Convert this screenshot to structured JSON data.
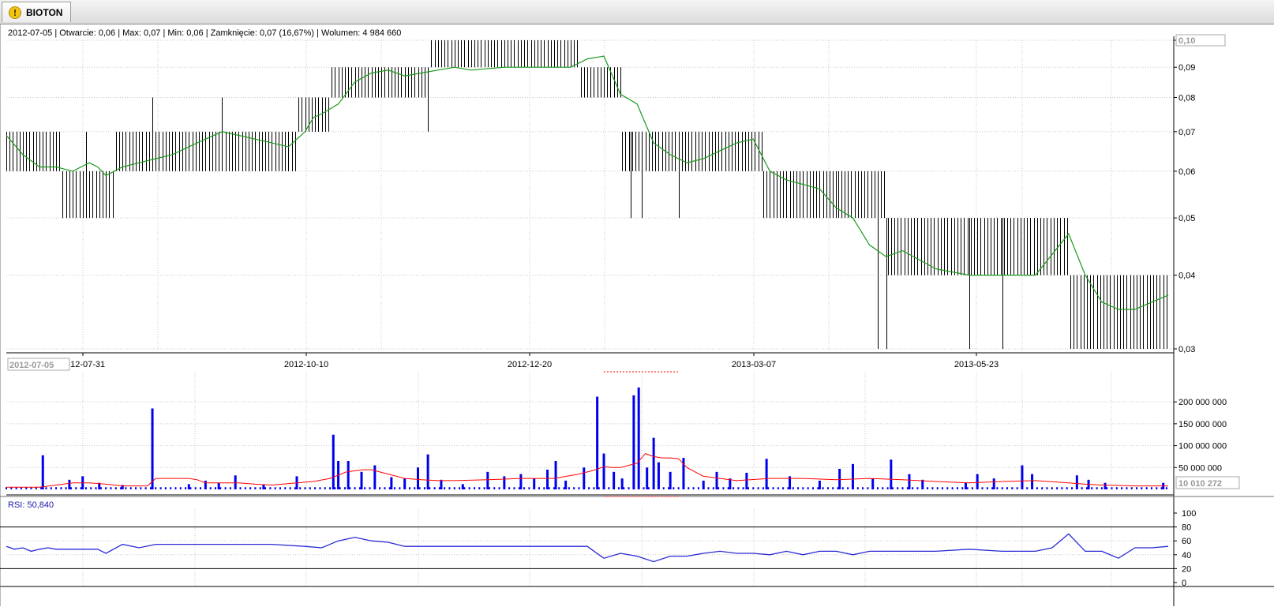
{
  "tab": {
    "label": "BIOTON",
    "icon": "warning-icon"
  },
  "info": {
    "text": "2012-07-05 | Otwarcie: 0,06 | Max: 0,07 | Min: 0,06 | Zamknięcie: 0,07 (16,67%)  | Wolumen: 4 984 660"
  },
  "cursor": {
    "date": "2012-07-05",
    "price": "0,10",
    "volume": "10 010 272"
  },
  "rsi": {
    "label": "RSI: 50,840"
  },
  "colors": {
    "ma": "#1a9a1a",
    "volume_bars": "#0000ee",
    "volume_ma": "#ff0000",
    "rsi_line": "#2a2ad6",
    "rsi_label": "#1a1aaa"
  },
  "chart_data": [
    {
      "type": "bar",
      "subtype": "ohlc-price",
      "x_ticks": [
        "2012-07-31",
        "2012-10-10",
        "2012-12-20",
        "2013-03-07",
        "2013-05-23"
      ],
      "y_ticks": [
        "0,10",
        "0,09",
        "0,08",
        "0,07",
        "0,06",
        "0,05",
        "0,04",
        "0,03"
      ],
      "ylim": [
        0.03,
        0.1
      ],
      "y_scale": "log",
      "grid": true,
      "segments": [
        {
          "from": 0,
          "to": 33,
          "low": 0.06,
          "high": 0.07
        },
        {
          "from": 34,
          "to": 65,
          "low": 0.05,
          "high": 0.06
        },
        {
          "from": 66,
          "to": 175,
          "low": 0.06,
          "high": 0.07
        },
        {
          "from": 176,
          "to": 195,
          "low": 0.07,
          "high": 0.08
        },
        {
          "from": 196,
          "to": 255,
          "low": 0.08,
          "high": 0.09
        },
        {
          "from": 256,
          "to": 345,
          "low": 0.09,
          "high": 0.1
        },
        {
          "from": 346,
          "to": 370,
          "low": 0.08,
          "high": 0.09
        },
        {
          "from": 371,
          "to": 455,
          "low": 0.06,
          "high": 0.07
        },
        {
          "from": 456,
          "to": 500,
          "low": 0.05,
          "high": 0.06
        },
        {
          "from": 501,
          "to": 530,
          "low": 0.05,
          "high": 0.06
        },
        {
          "from": 531,
          "to": 640,
          "low": 0.04,
          "high": 0.05
        },
        {
          "from": 641,
          "to": 700,
          "low": 0.03,
          "high": 0.04
        }
      ],
      "spikes": [
        {
          "i": 48,
          "low": 0.05,
          "high": 0.07
        },
        {
          "i": 88,
          "low": 0.06,
          "high": 0.08
        },
        {
          "i": 130,
          "low": 0.06,
          "high": 0.08
        },
        {
          "i": 254,
          "low": 0.07,
          "high": 0.09
        },
        {
          "i": 376,
          "low": 0.05,
          "high": 0.07
        },
        {
          "i": 383,
          "low": 0.05,
          "high": 0.07
        },
        {
          "i": 405,
          "low": 0.05,
          "high": 0.07
        },
        {
          "i": 525,
          "low": 0.03,
          "high": 0.05
        },
        {
          "i": 530,
          "low": 0.03,
          "high": 0.05
        },
        {
          "i": 580,
          "low": 0.03,
          "high": 0.05
        },
        {
          "i": 600,
          "low": 0.03,
          "high": 0.05
        }
      ],
      "series": [
        {
          "kind": "moving-average",
          "x": [
            0,
            10,
            20,
            30,
            40,
            50,
            55,
            60,
            65,
            70,
            80,
            90,
            100,
            110,
            120,
            130,
            140,
            150,
            160,
            170,
            180,
            185,
            190,
            200,
            210,
            220,
            230,
            240,
            250,
            260,
            270,
            280,
            300,
            320,
            340,
            350,
            360,
            370,
            380,
            390,
            400,
            410,
            420,
            430,
            440,
            450,
            460,
            470,
            480,
            490,
            500,
            510,
            520,
            530,
            540,
            560,
            580,
            600,
            620,
            640,
            650,
            660,
            670,
            680,
            690,
            700
          ],
          "y": [
            0.069,
            0.064,
            0.061,
            0.061,
            0.06,
            0.062,
            0.061,
            0.059,
            0.06,
            0.061,
            0.062,
            0.063,
            0.064,
            0.066,
            0.068,
            0.07,
            0.069,
            0.068,
            0.067,
            0.066,
            0.07,
            0.074,
            0.075,
            0.078,
            0.085,
            0.088,
            0.089,
            0.087,
            0.088,
            0.089,
            0.09,
            0.089,
            0.09,
            0.09,
            0.09,
            0.093,
            0.094,
            0.081,
            0.078,
            0.067,
            0.064,
            0.062,
            0.063,
            0.065,
            0.067,
            0.068,
            0.06,
            0.058,
            0.057,
            0.056,
            0.052,
            0.05,
            0.045,
            0.043,
            0.044,
            0.041,
            0.04,
            0.04,
            0.04,
            0.047,
            0.04,
            0.036,
            0.035,
            0.035,
            0.036,
            0.037
          ]
        }
      ]
    },
    {
      "type": "bar",
      "subtype": "volume",
      "y_ticks": [
        "200 000 000",
        "150 000 000",
        "100 000 000",
        "50 000 000"
      ],
      "ylim": [
        0,
        240000000
      ],
      "grid": true,
      "baseline": 5000000,
      "bars": [
        {
          "i": 22,
          "v": 78000000
        },
        {
          "i": 38,
          "v": 22000000
        },
        {
          "i": 46,
          "v": 30000000
        },
        {
          "i": 56,
          "v": 15000000
        },
        {
          "i": 70,
          "v": 10000000
        },
        {
          "i": 88,
          "v": 185000000
        },
        {
          "i": 110,
          "v": 12000000
        },
        {
          "i": 120,
          "v": 20000000
        },
        {
          "i": 128,
          "v": 15000000
        },
        {
          "i": 138,
          "v": 32000000
        },
        {
          "i": 155,
          "v": 10000000
        },
        {
          "i": 175,
          "v": 30000000
        },
        {
          "i": 197,
          "v": 125000000
        },
        {
          "i": 200,
          "v": 65000000
        },
        {
          "i": 206,
          "v": 65000000
        },
        {
          "i": 214,
          "v": 40000000
        },
        {
          "i": 222,
          "v": 55000000
        },
        {
          "i": 232,
          "v": 28000000
        },
        {
          "i": 240,
          "v": 25000000
        },
        {
          "i": 248,
          "v": 50000000
        },
        {
          "i": 254,
          "v": 80000000
        },
        {
          "i": 262,
          "v": 22000000
        },
        {
          "i": 275,
          "v": 12000000
        },
        {
          "i": 290,
          "v": 40000000
        },
        {
          "i": 300,
          "v": 30000000
        },
        {
          "i": 310,
          "v": 35000000
        },
        {
          "i": 318,
          "v": 25000000
        },
        {
          "i": 326,
          "v": 45000000
        },
        {
          "i": 331,
          "v": 65000000
        },
        {
          "i": 337,
          "v": 20000000
        },
        {
          "i": 348,
          "v": 50000000
        },
        {
          "i": 356,
          "v": 212000000
        },
        {
          "i": 360,
          "v": 82000000
        },
        {
          "i": 366,
          "v": 40000000
        },
        {
          "i": 371,
          "v": 25000000
        },
        {
          "i": 378,
          "v": 215000000
        },
        {
          "i": 381,
          "v": 233000000
        },
        {
          "i": 386,
          "v": 50000000
        },
        {
          "i": 390,
          "v": 118000000
        },
        {
          "i": 393,
          "v": 62000000
        },
        {
          "i": 400,
          "v": 40000000
        },
        {
          "i": 408,
          "v": 72000000
        },
        {
          "i": 420,
          "v": 20000000
        },
        {
          "i": 428,
          "v": 40000000
        },
        {
          "i": 436,
          "v": 25000000
        },
        {
          "i": 446,
          "v": 38000000
        },
        {
          "i": 458,
          "v": 70000000
        },
        {
          "i": 472,
          "v": 30000000
        },
        {
          "i": 490,
          "v": 20000000
        },
        {
          "i": 502,
          "v": 47000000
        },
        {
          "i": 510,
          "v": 58000000
        },
        {
          "i": 522,
          "v": 25000000
        },
        {
          "i": 533,
          "v": 68000000
        },
        {
          "i": 544,
          "v": 35000000
        },
        {
          "i": 552,
          "v": 22000000
        },
        {
          "i": 578,
          "v": 15000000
        },
        {
          "i": 585,
          "v": 35000000
        },
        {
          "i": 595,
          "v": 25000000
        },
        {
          "i": 612,
          "v": 55000000
        },
        {
          "i": 618,
          "v": 35000000
        },
        {
          "i": 645,
          "v": 32000000
        },
        {
          "i": 652,
          "v": 22000000
        },
        {
          "i": 662,
          "v": 15000000
        },
        {
          "i": 697,
          "v": 15000000
        }
      ],
      "series": [
        {
          "kind": "moving-average",
          "x": [
            0,
            20,
            30,
            40,
            50,
            60,
            70,
            85,
            90,
            100,
            110,
            115,
            120,
            130,
            140,
            150,
            160,
            175,
            185,
            195,
            205,
            215,
            220,
            230,
            240,
            250,
            260,
            270,
            290,
            310,
            330,
            345,
            355,
            360,
            365,
            370,
            375,
            380,
            385,
            390,
            395,
            400,
            405,
            410,
            420,
            440,
            460,
            480,
            500,
            520,
            540,
            560,
            580,
            600,
            620,
            640,
            650,
            660,
            680,
            700
          ],
          "y": [
            5000000,
            5000000,
            10000000,
            15000000,
            15000000,
            12000000,
            8000000,
            8000000,
            25000000,
            25000000,
            25000000,
            22000000,
            15000000,
            15000000,
            15000000,
            12000000,
            10000000,
            15000000,
            18000000,
            25000000,
            40000000,
            45000000,
            45000000,
            35000000,
            25000000,
            22000000,
            20000000,
            20000000,
            22000000,
            25000000,
            25000000,
            35000000,
            45000000,
            52000000,
            50000000,
            50000000,
            55000000,
            60000000,
            82000000,
            75000000,
            72000000,
            72000000,
            70000000,
            50000000,
            30000000,
            20000000,
            25000000,
            25000000,
            22000000,
            25000000,
            22000000,
            18000000,
            15000000,
            18000000,
            20000000,
            15000000,
            12000000,
            10000000,
            8000000,
            8000000
          ]
        }
      ]
    },
    {
      "type": "line",
      "subtype": "rsi",
      "y_ticks": [
        "100",
        "80",
        "60",
        "40",
        "20",
        "0"
      ],
      "ylim": [
        0,
        100
      ],
      "reference_lines": [
        80,
        20
      ],
      "series": [
        {
          "name": "RSI",
          "x": [
            0,
            5,
            10,
            15,
            20,
            25,
            30,
            40,
            50,
            55,
            60,
            70,
            80,
            90,
            100,
            120,
            140,
            160,
            180,
            190,
            200,
            210,
            220,
            230,
            240,
            250,
            260,
            270,
            280,
            290,
            300,
            310,
            320,
            330,
            340,
            350,
            360,
            370,
            380,
            390,
            400,
            410,
            420,
            430,
            440,
            450,
            460,
            470,
            480,
            490,
            500,
            510,
            520,
            540,
            560,
            580,
            600,
            620,
            630,
            640,
            650,
            660,
            670,
            680,
            690,
            700
          ],
          "y": [
            52,
            48,
            50,
            45,
            48,
            50,
            48,
            48,
            48,
            48,
            42,
            55,
            50,
            55,
            55,
            55,
            55,
            55,
            52,
            50,
            60,
            65,
            60,
            58,
            52,
            52,
            52,
            52,
            52,
            52,
            52,
            52,
            52,
            52,
            52,
            52,
            35,
            42,
            38,
            30,
            38,
            38,
            42,
            45,
            42,
            42,
            40,
            45,
            40,
            45,
            45,
            40,
            45,
            45,
            45,
            48,
            45,
            45,
            50,
            70,
            45,
            45,
            35,
            50,
            50,
            52
          ]
        }
      ]
    }
  ]
}
